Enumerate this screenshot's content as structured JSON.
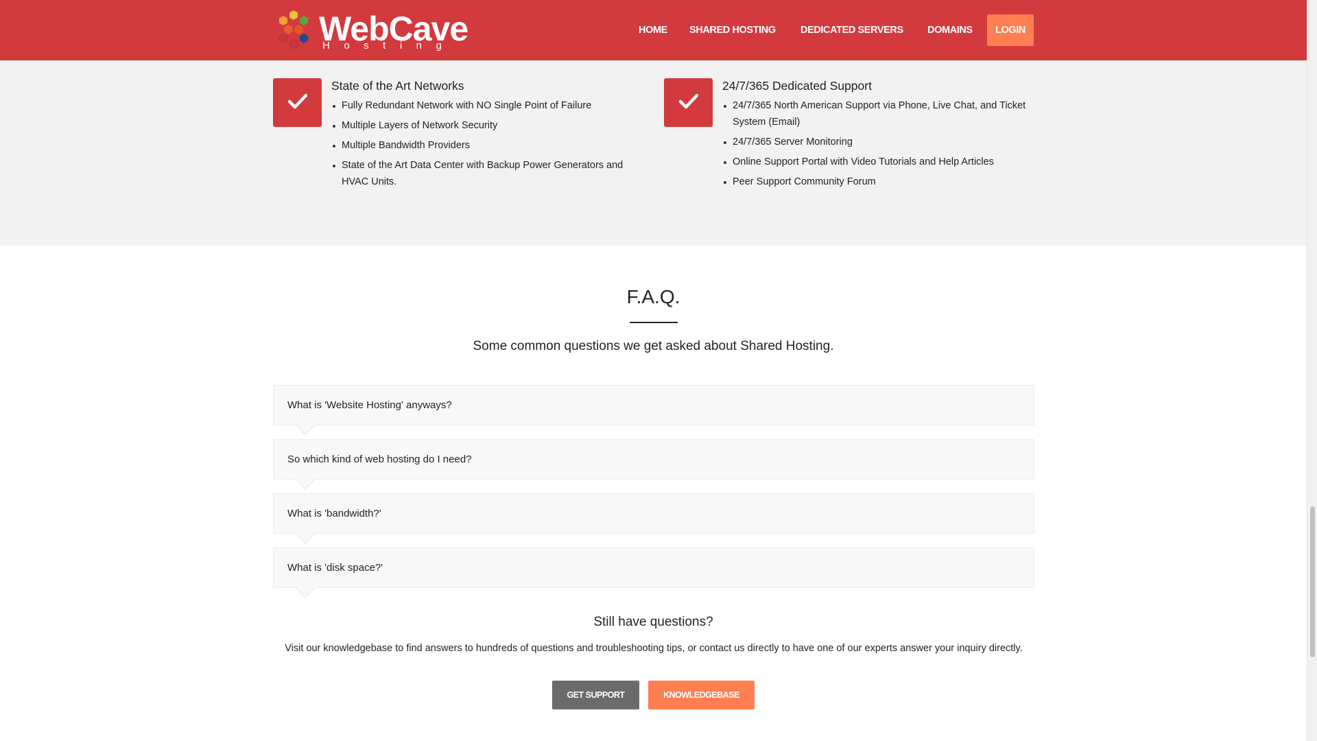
{
  "brand": {
    "name": "WebCave",
    "tagline": "Hosting",
    "colors": {
      "primary": "#d23a3e",
      "accent": "#ff7f50"
    }
  },
  "nav": {
    "items": [
      {
        "label": "HOME"
      },
      {
        "label": "SHARED HOSTING"
      },
      {
        "label": "DEDICATED SERVERS"
      },
      {
        "label": "DOMAINS"
      }
    ],
    "login_label": "LOGIN"
  },
  "features": [
    {
      "icon": "checkmark-icon",
      "title": "State of the Art Networks",
      "items": [
        "Fully Redundant Network with NO Single Point of Failure",
        "Multiple Layers of Network Security",
        "Multiple Bandwidth Providers",
        "State of the Art Data Center with Backup Power Generators and HVAC Units."
      ]
    },
    {
      "icon": "checkmark-icon",
      "title": "24/7/365 Dedicated Support",
      "items": [
        "24/7/365 North American Support via Phone, Live Chat, and Ticket System (Email)",
        "24/7/365 Server Monitoring",
        "Online Support Portal with Video Tutorials and Help Articles",
        "Peer Support Community Forum"
      ]
    }
  ],
  "faq": {
    "title": "F.A.Q.",
    "subtitle": "Some common questions we get asked about Shared Hosting.",
    "questions": [
      "What is 'Website Hosting' anyways?",
      "So which kind of web hosting do I need?",
      "What is 'bandwidth?'",
      "What is 'disk space?'"
    ]
  },
  "still_questions": {
    "title": "Still have questions?",
    "body": "Visit our knowledgebase to find answers to hundreds of questions and troubleshooting tips, or contact us directly to have one of our experts answer your inquiry directly.",
    "get_support_label": "GET SUPPORT",
    "knowledgebase_label": "KNOWLEDGEBASE"
  }
}
